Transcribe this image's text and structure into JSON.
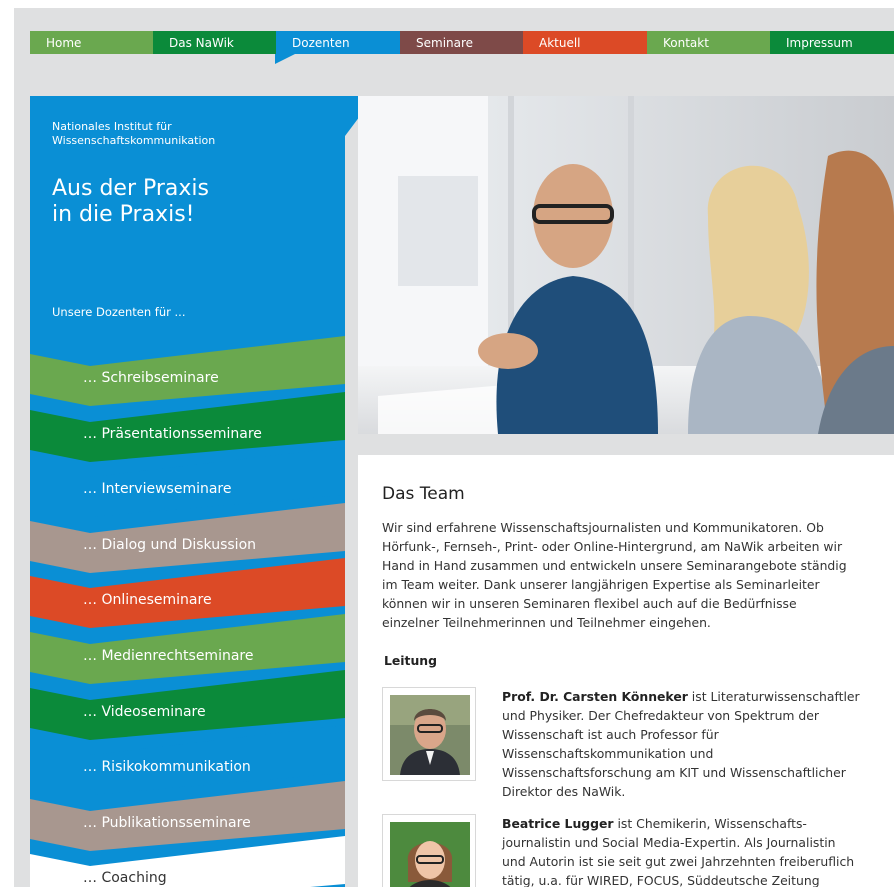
{
  "nav": {
    "items": [
      {
        "label": "Home",
        "color": "#6aa84f"
      },
      {
        "label": "Das NaWik",
        "color": "#0b8a3a"
      },
      {
        "label": "Dozenten",
        "color": "#0a8fd5",
        "active": true
      },
      {
        "label": "Seminare",
        "color": "#7e4a48"
      },
      {
        "label": "Aktuell",
        "color": "#dc4a26"
      },
      {
        "label": "Kontakt",
        "color": "#6aa84f"
      },
      {
        "label": "Impressum",
        "color": "#0b8a3a"
      }
    ]
  },
  "sidebar": {
    "org_line1": "Nationales Institut für",
    "org_line2": "Wissenschaftskommunikation",
    "slogan_line1": "Aus der Praxis",
    "slogan_line2": "in die Praxis!",
    "intro": "Unsere Dozenten für ...",
    "background": "#0a8fd5",
    "items": [
      {
        "label": "… Schreibseminare",
        "color": "#6aa84f"
      },
      {
        "label": "… Präsentationsseminare",
        "color": "#0b8a3a"
      },
      {
        "label": "… Interviewseminare",
        "color": "#0a8fd5"
      },
      {
        "label": "… Dialog und Diskussion",
        "color": "#a8978f"
      },
      {
        "label": "… Onlineseminare",
        "color": "#dc4a26"
      },
      {
        "label": "… Medienrechtseminare",
        "color": "#6aa84f"
      },
      {
        "label": "… Videoseminare",
        "color": "#0b8a3a"
      },
      {
        "label": "… Risikokommunikation",
        "color": "#0a8fd5"
      },
      {
        "label": "… Publikationsseminare",
        "color": "#a8978f"
      },
      {
        "label": "… Coaching",
        "color": "#ffffff"
      }
    ]
  },
  "content": {
    "title": "Das Team",
    "intro_lines": [
      "Wir sind erfahrene Wissenschaftsjournalisten und Kommunikatoren. Ob",
      "Hörfunk-, Fernseh-, Print- oder Online-Hintergrund, am NaWik arbeiten wir",
      "Hand in Hand zusammen und entwickeln unsere Seminarangebote ständig",
      "im Team weiter. Dank unserer langjährigen Expertise als Seminarleiter",
      "können wir in unseren Seminaren flexibel auch auf die Bedürfnisse",
      "einzelner Teilnehmerinnen und Teilnehmer eingehen."
    ],
    "section": "Leitung",
    "people": [
      {
        "name": "Prof. Dr. Carsten Könneker",
        "bio_lines": [
          " ist Literaturwissenschaftler",
          "und Physiker. Der Chefredakteur von Spektrum der",
          "Wissenschaft ist auch Professor für",
          "Wissenschaftskommunikation und",
          "Wissenschaftsforschung am KIT und Wissenschaftlicher",
          "Direktor des NaWik."
        ]
      },
      {
        "name": "Beatrice Lugger",
        "bio_lines": [
          " ist Chemikerin, Wissenschafts-",
          "journalistin und Social Media-Expertin. Als Journalistin",
          "und Autorin ist sie seit gut zwei Jahrzehnten freiberuflich",
          "tätig, u.a. für WIRED, FOCUS, Süddeutsche Zeitung"
        ]
      }
    ]
  }
}
